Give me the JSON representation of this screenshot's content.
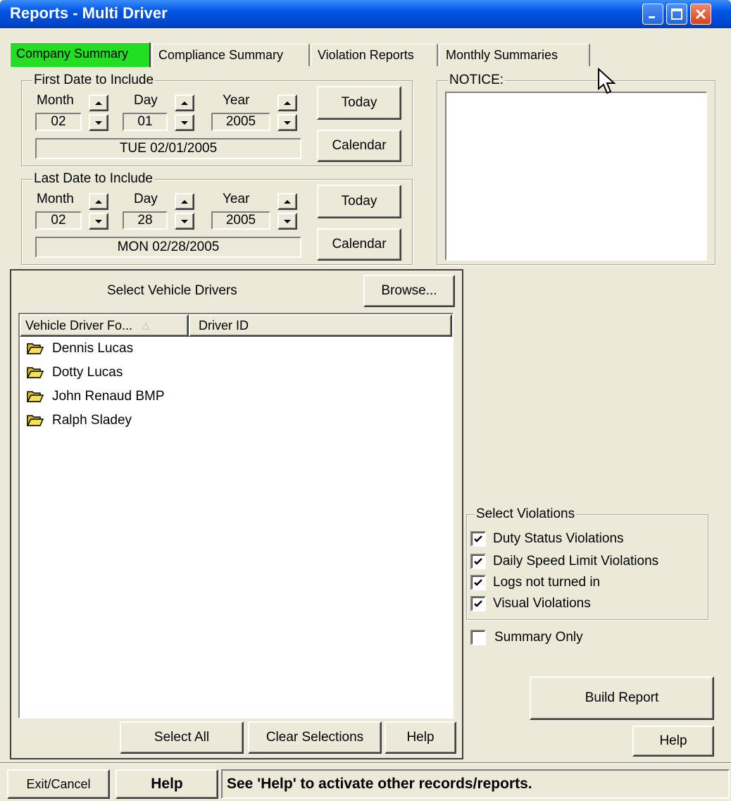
{
  "window": {
    "title": "Reports - Multi Driver"
  },
  "tabs": [
    "Company Summary",
    "Compliance Summary",
    "Violation Reports",
    "Monthly Summaries"
  ],
  "first_date": {
    "legend": "First Date to Include",
    "month_label": "Month",
    "day_label": "Day",
    "year_label": "Year",
    "month": "02",
    "day": "01",
    "year": "2005",
    "display": "TUE 02/01/2005",
    "today": "Today",
    "calendar": "Calendar"
  },
  "last_date": {
    "legend": "Last Date to Include",
    "month_label": "Month",
    "day_label": "Day",
    "year_label": "Year",
    "month": "02",
    "day": "28",
    "year": "2005",
    "display": "MON 02/28/2005",
    "today": "Today",
    "calendar": "Calendar"
  },
  "notice": {
    "legend": "NOTICE:",
    "text": ""
  },
  "drivers": {
    "title": "Select Vehicle Drivers",
    "browse": "Browse...",
    "columns": [
      "Vehicle Driver Fo...",
      "Driver ID"
    ],
    "items": [
      "Dennis Lucas",
      "Dotty Lucas",
      "John Renaud BMP",
      "Ralph Sladey"
    ],
    "select_all": "Select All",
    "clear": "Clear Selections",
    "help": "Help"
  },
  "violations": {
    "legend": "Select Violations",
    "items": [
      {
        "label": "Duty Status Violations",
        "checked": true
      },
      {
        "label": "Daily Speed Limit Violations",
        "checked": true
      },
      {
        "label": "Logs not turned in",
        "checked": true
      },
      {
        "label": "Visual Violations",
        "checked": true
      }
    ]
  },
  "summary_only": {
    "label": "Summary Only",
    "checked": false
  },
  "build_report": "Build Report",
  "help_right": "Help",
  "footer": {
    "exit": "Exit/Cancel",
    "help": "Help",
    "status": "See 'Help' to activate other records/reports."
  },
  "colors": {
    "titlebar": "#0055e5",
    "active_tab": "#21e021",
    "face": "#ece9d8"
  }
}
